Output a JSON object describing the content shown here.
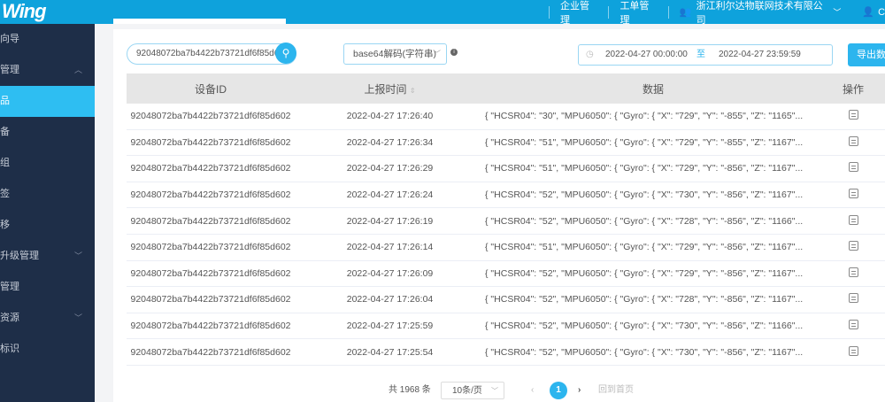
{
  "header": {
    "logo": "Wing",
    "nav": [
      "企业管理",
      "工单管理"
    ],
    "company": "浙江利尔达物联网技术有限公司",
    "user": "C"
  },
  "sidebar": {
    "items": [
      {
        "label": "向导"
      },
      {
        "label": "管理",
        "chev": "^"
      },
      {
        "label": "品",
        "active": true
      },
      {
        "label": "备"
      },
      {
        "label": "组"
      },
      {
        "label": "签"
      },
      {
        "label": "移"
      },
      {
        "label": "升级管理",
        "chev": "v"
      },
      {
        "label": "管理"
      },
      {
        "label": "资源",
        "chev": "v"
      },
      {
        "label": "标识"
      }
    ]
  },
  "filters": {
    "search_value": "92048072ba7b4422b73721df6f85d602",
    "decode_select": "base64解码(字符串)",
    "date_start": "2022-04-27 00:00:00",
    "date_sep": "至",
    "date_end": "2022-04-27 23:59:59",
    "export_label": "导出数"
  },
  "table": {
    "headers": [
      "设备ID",
      "上报时间",
      "数据",
      "操作"
    ],
    "rows": [
      [
        "92048072ba7b4422b73721df6f85d602",
        "2022-04-27 17:26:40",
        "{ \"HCSR04\": \"30\", \"MPU6050\": { \"Gyro\": { \"X\": \"729\", \"Y\": \"-855\", \"Z\": \"1165\"..."
      ],
      [
        "92048072ba7b4422b73721df6f85d602",
        "2022-04-27 17:26:34",
        "{ \"HCSR04\": \"51\", \"MPU6050\": { \"Gyro\": { \"X\": \"729\", \"Y\": \"-855\", \"Z\": \"1167\"..."
      ],
      [
        "92048072ba7b4422b73721df6f85d602",
        "2022-04-27 17:26:29",
        "{ \"HCSR04\": \"51\", \"MPU6050\": { \"Gyro\": { \"X\": \"729\", \"Y\": \"-856\", \"Z\": \"1167\"..."
      ],
      [
        "92048072ba7b4422b73721df6f85d602",
        "2022-04-27 17:26:24",
        "{ \"HCSR04\": \"52\", \"MPU6050\": { \"Gyro\": { \"X\": \"730\", \"Y\": \"-856\", \"Z\": \"1167\"..."
      ],
      [
        "92048072ba7b4422b73721df6f85d602",
        "2022-04-27 17:26:19",
        "{ \"HCSR04\": \"52\", \"MPU6050\": { \"Gyro\": { \"X\": \"728\", \"Y\": \"-856\", \"Z\": \"1166\"..."
      ],
      [
        "92048072ba7b4422b73721df6f85d602",
        "2022-04-27 17:26:14",
        "{ \"HCSR04\": \"51\", \"MPU6050\": { \"Gyro\": { \"X\": \"729\", \"Y\": \"-856\", \"Z\": \"1167\"..."
      ],
      [
        "92048072ba7b4422b73721df6f85d602",
        "2022-04-27 17:26:09",
        "{ \"HCSR04\": \"52\", \"MPU6050\": { \"Gyro\": { \"X\": \"729\", \"Y\": \"-856\", \"Z\": \"1167\"..."
      ],
      [
        "92048072ba7b4422b73721df6f85d602",
        "2022-04-27 17:26:04",
        "{ \"HCSR04\": \"52\", \"MPU6050\": { \"Gyro\": { \"X\": \"728\", \"Y\": \"-856\", \"Z\": \"1167\"..."
      ],
      [
        "92048072ba7b4422b73721df6f85d602",
        "2022-04-27 17:25:59",
        "{ \"HCSR04\": \"52\", \"MPU6050\": { \"Gyro\": { \"X\": \"730\", \"Y\": \"-856\", \"Z\": \"1166\"..."
      ],
      [
        "92048072ba7b4422b73721df6f85d602",
        "2022-04-27 17:25:54",
        "{ \"HCSR04\": \"52\", \"MPU6050\": { \"Gyro\": { \"X\": \"730\", \"Y\": \"-856\", \"Z\": \"1167\"..."
      ]
    ]
  },
  "pager": {
    "total": "共 1968 条",
    "page_size": "10条/页",
    "current": "1",
    "back_first": "回到首页"
  },
  "colors": {
    "header": "#0ea2dc",
    "sidebar": "#1e2e48",
    "accent": "#2cb5ee"
  }
}
